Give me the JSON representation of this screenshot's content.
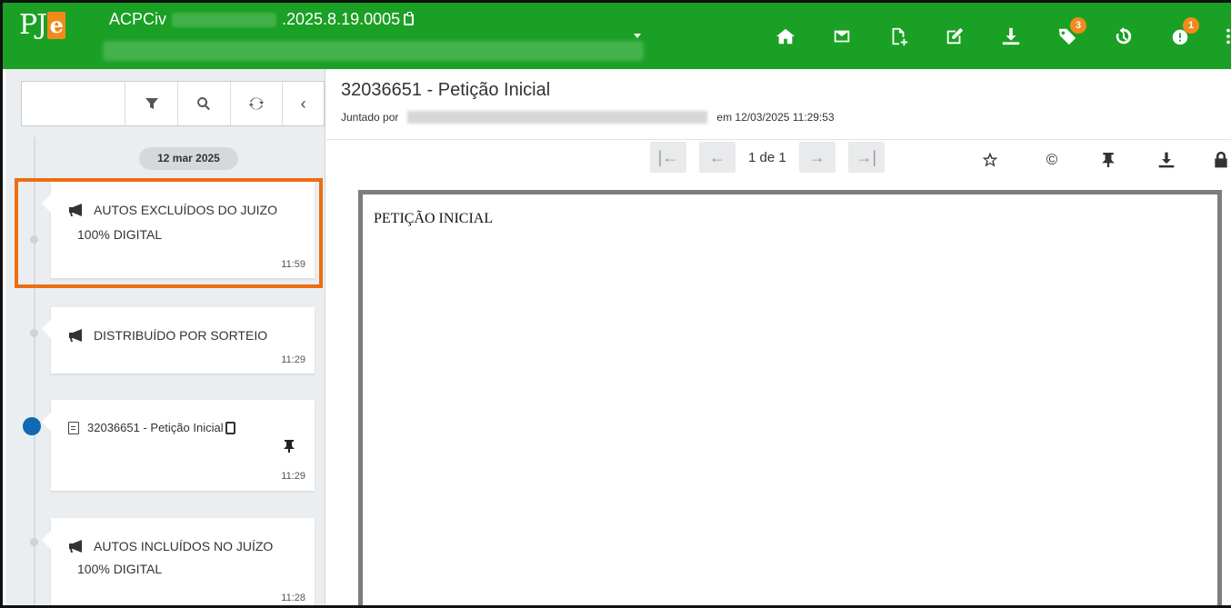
{
  "header": {
    "app_logo_text": "PJ",
    "app_logo_e": "e",
    "process_class": "ACPCiv",
    "process_number_suffix": ".2025.8.19.0005",
    "icons": [
      {
        "name": "home-icon"
      },
      {
        "name": "mail-icon"
      },
      {
        "name": "new-document-icon"
      },
      {
        "name": "edit-icon"
      },
      {
        "name": "download-icon"
      },
      {
        "name": "tags-icon",
        "badge": "3"
      },
      {
        "name": "history-icon"
      },
      {
        "name": "alerts-icon",
        "badge": "1"
      }
    ],
    "accent_color": "#1aa024",
    "badge_color": "#f28a1b"
  },
  "sidebar": {
    "date_chip": "12 mar 2025",
    "events": [
      {
        "icon": "megaphone-icon",
        "line1": "AUTOS EXCLUÍDOS DO JUIZO",
        "line2": "100% DIGITAL",
        "time": "11:59",
        "highlighted": true
      },
      {
        "icon": "megaphone-icon",
        "line1": "DISTRIBUÍDO POR SORTEIO",
        "line2": "",
        "time": "11:29"
      },
      {
        "icon": "document-icon",
        "line1": "32036651 - Petição Inicial",
        "line2": "",
        "time": "11:29",
        "active": true
      },
      {
        "icon": "megaphone-icon",
        "line1": "AUTOS INCLUÍDOS NO JUÍZO",
        "line2": "100% DIGITAL",
        "time": "11:28"
      }
    ],
    "highlight_color": "#ec6e12",
    "active_dot_color": "#1168b3"
  },
  "main": {
    "doc_title": "32036651 - Petição Inicial",
    "joined_label": "Juntado por",
    "joined_date": "em 12/03/2025 11:29:53",
    "pager_label": "1 de 1",
    "document_heading": "PETIÇÃO INICIAL"
  }
}
